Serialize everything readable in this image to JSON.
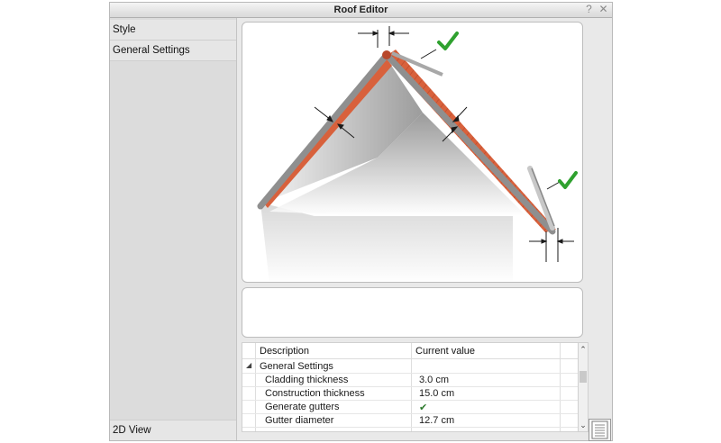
{
  "window": {
    "title": "Roof Editor",
    "help_icon": "question-icon",
    "close_icon": "close-icon"
  },
  "sidebar": {
    "items": [
      {
        "label": "Style"
      },
      {
        "label": "General Settings"
      }
    ],
    "bottom_item": {
      "label": "2D View"
    }
  },
  "preview": {
    "image": "gable-roof-illustration",
    "colors": {
      "tiles": "#d8613c",
      "tiles_dark": "#b8472a",
      "frame": "#8f8f8f",
      "check": "#2fa12f"
    }
  },
  "properties": {
    "columns": [
      "Description",
      "Current value"
    ],
    "group": {
      "label": "General Settings",
      "expanded": true
    },
    "rows": [
      {
        "description": "Cladding thickness",
        "value": "3.0 cm"
      },
      {
        "description": "Construction thickness",
        "value": "15.0 cm"
      },
      {
        "description": "Generate gutters",
        "value": "✔"
      },
      {
        "description": "Gutter diameter",
        "value": "12.7 cm"
      }
    ]
  },
  "panel_toggle": {
    "icon": "list-panel-icon"
  }
}
